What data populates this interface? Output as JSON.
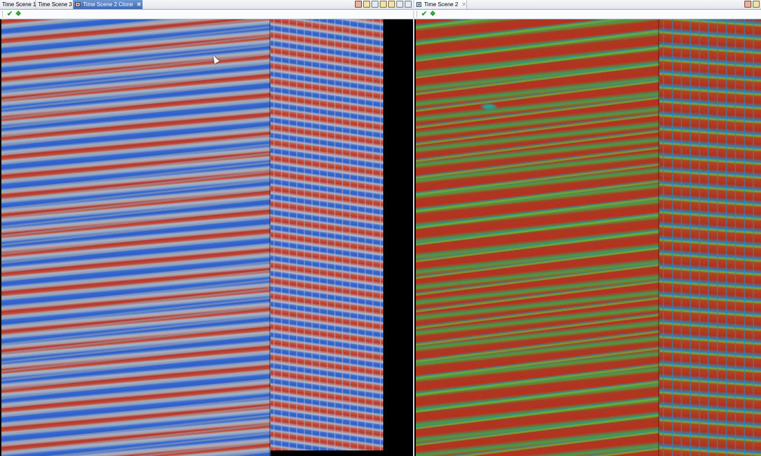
{
  "left_panel": {
    "tabs": [
      {
        "label": "Time Scene 1",
        "active": false
      },
      {
        "label": "Time Scene 3",
        "active": false
      },
      {
        "label": "Time Scene 2 Clone",
        "active": true,
        "closable": true
      }
    ],
    "close_glyph": "✕",
    "toolbar_icons": [
      "scene-settings-icon",
      "palette-icon",
      "camera-icon",
      "layers-icon",
      "lock-icon",
      "minimize-window-icon",
      "maximize-window-icon"
    ],
    "subbar_icons": [
      "apply-check-icon",
      "apply-all-check-icon"
    ],
    "view": {
      "type": "seismic-section",
      "colormap": "red-white-blue"
    }
  },
  "right_panel": {
    "tabs": [
      {
        "label": "Time Scene 2",
        "active": false,
        "closable": true
      }
    ],
    "close_glyph": "✕",
    "toolbar_icons": [
      "scene-settings-icon",
      "palette-icon"
    ],
    "subbar_icons": [
      "apply-check-icon",
      "apply-all-check-icon"
    ],
    "view": {
      "type": "seismic-attribute",
      "colormap": "red-green-blue"
    }
  },
  "colors": {
    "active_tab": "#3d6bb5",
    "check_icon": "#2f9a2f",
    "seismic_red": "#b8392c",
    "seismic_blue": "#2f5fc9",
    "attribute_green": "#6b8b34"
  }
}
